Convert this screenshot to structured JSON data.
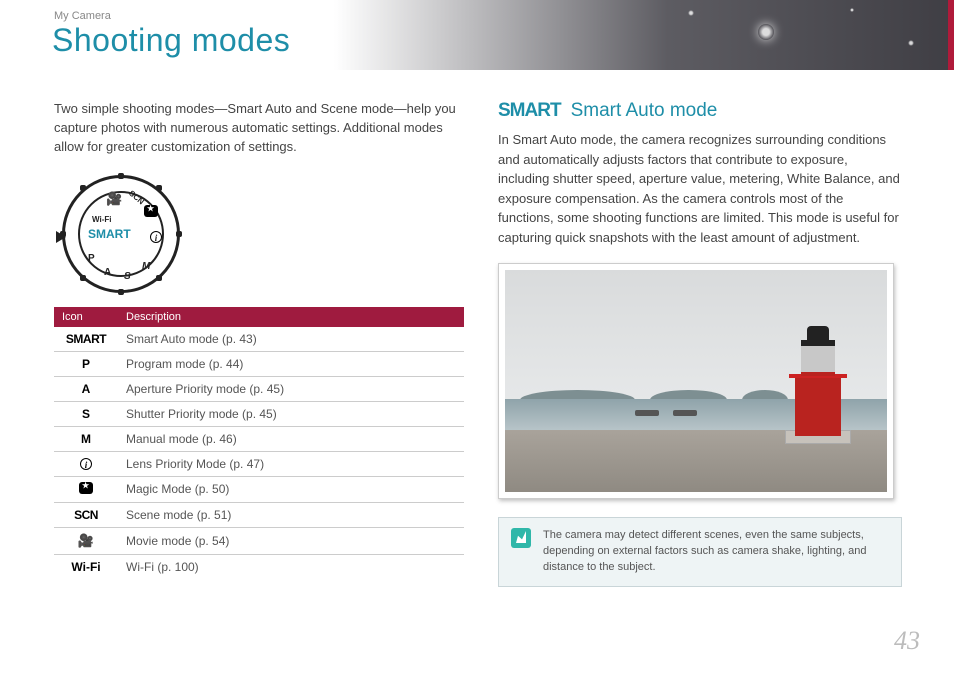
{
  "header": {
    "breadcrumb": "My Camera",
    "title": "Shooting modes"
  },
  "left": {
    "intro": "Two simple shooting modes—Smart Auto and Scene mode—help you capture photos with numerous automatic settings. Additional modes allow for greater customization of settings.",
    "dial": {
      "smart": "SMART",
      "wifi": "Wi-Fi",
      "p": "P",
      "a": "A",
      "s": "S",
      "m": "M",
      "scn": "SCN"
    },
    "table": {
      "head_icon": "Icon",
      "head_desc": "Description",
      "rows": [
        {
          "icon": "SMART",
          "icon_class": "smart",
          "desc": "Smart Auto mode (p. 43)"
        },
        {
          "icon": "P",
          "icon_class": "",
          "desc": "Program mode (p. 44)"
        },
        {
          "icon": "A",
          "icon_class": "",
          "desc": "Aperture Priority mode (p. 45)"
        },
        {
          "icon": "S",
          "icon_class": "",
          "desc": "Shutter Priority mode (p. 45)"
        },
        {
          "icon": "M",
          "icon_class": "",
          "desc": "Manual mode (p. 46)"
        },
        {
          "icon": "i",
          "icon_class": "circ",
          "desc": "Lens Priority Mode (p. 47)"
        },
        {
          "icon": "star",
          "icon_class": "star",
          "desc": "Magic Mode (p. 50)"
        },
        {
          "icon": "SCN",
          "icon_class": "scn",
          "desc": "Scene mode (p. 51)"
        },
        {
          "icon": "movie",
          "icon_class": "movie",
          "desc": "Movie mode (p. 54)"
        },
        {
          "icon": "Wi-Fi",
          "icon_class": "wifi",
          "desc": "Wi-Fi (p. 100)"
        }
      ]
    }
  },
  "right": {
    "smart_word": "SMART",
    "section_title": "Smart Auto mode",
    "body": "In Smart Auto mode, the camera recognizes surrounding conditions and automatically adjusts factors that contribute to exposure, including shutter speed, aperture value, metering, White Balance, and exposure compensation. As the camera controls most of the functions, some shooting functions are limited. This mode is useful for capturing quick snapshots with the least amount of adjustment.",
    "note": "The camera may detect different scenes, even the same subjects, depending on external factors such as camera shake, lighting, and distance to the subject."
  },
  "page_number": "43"
}
